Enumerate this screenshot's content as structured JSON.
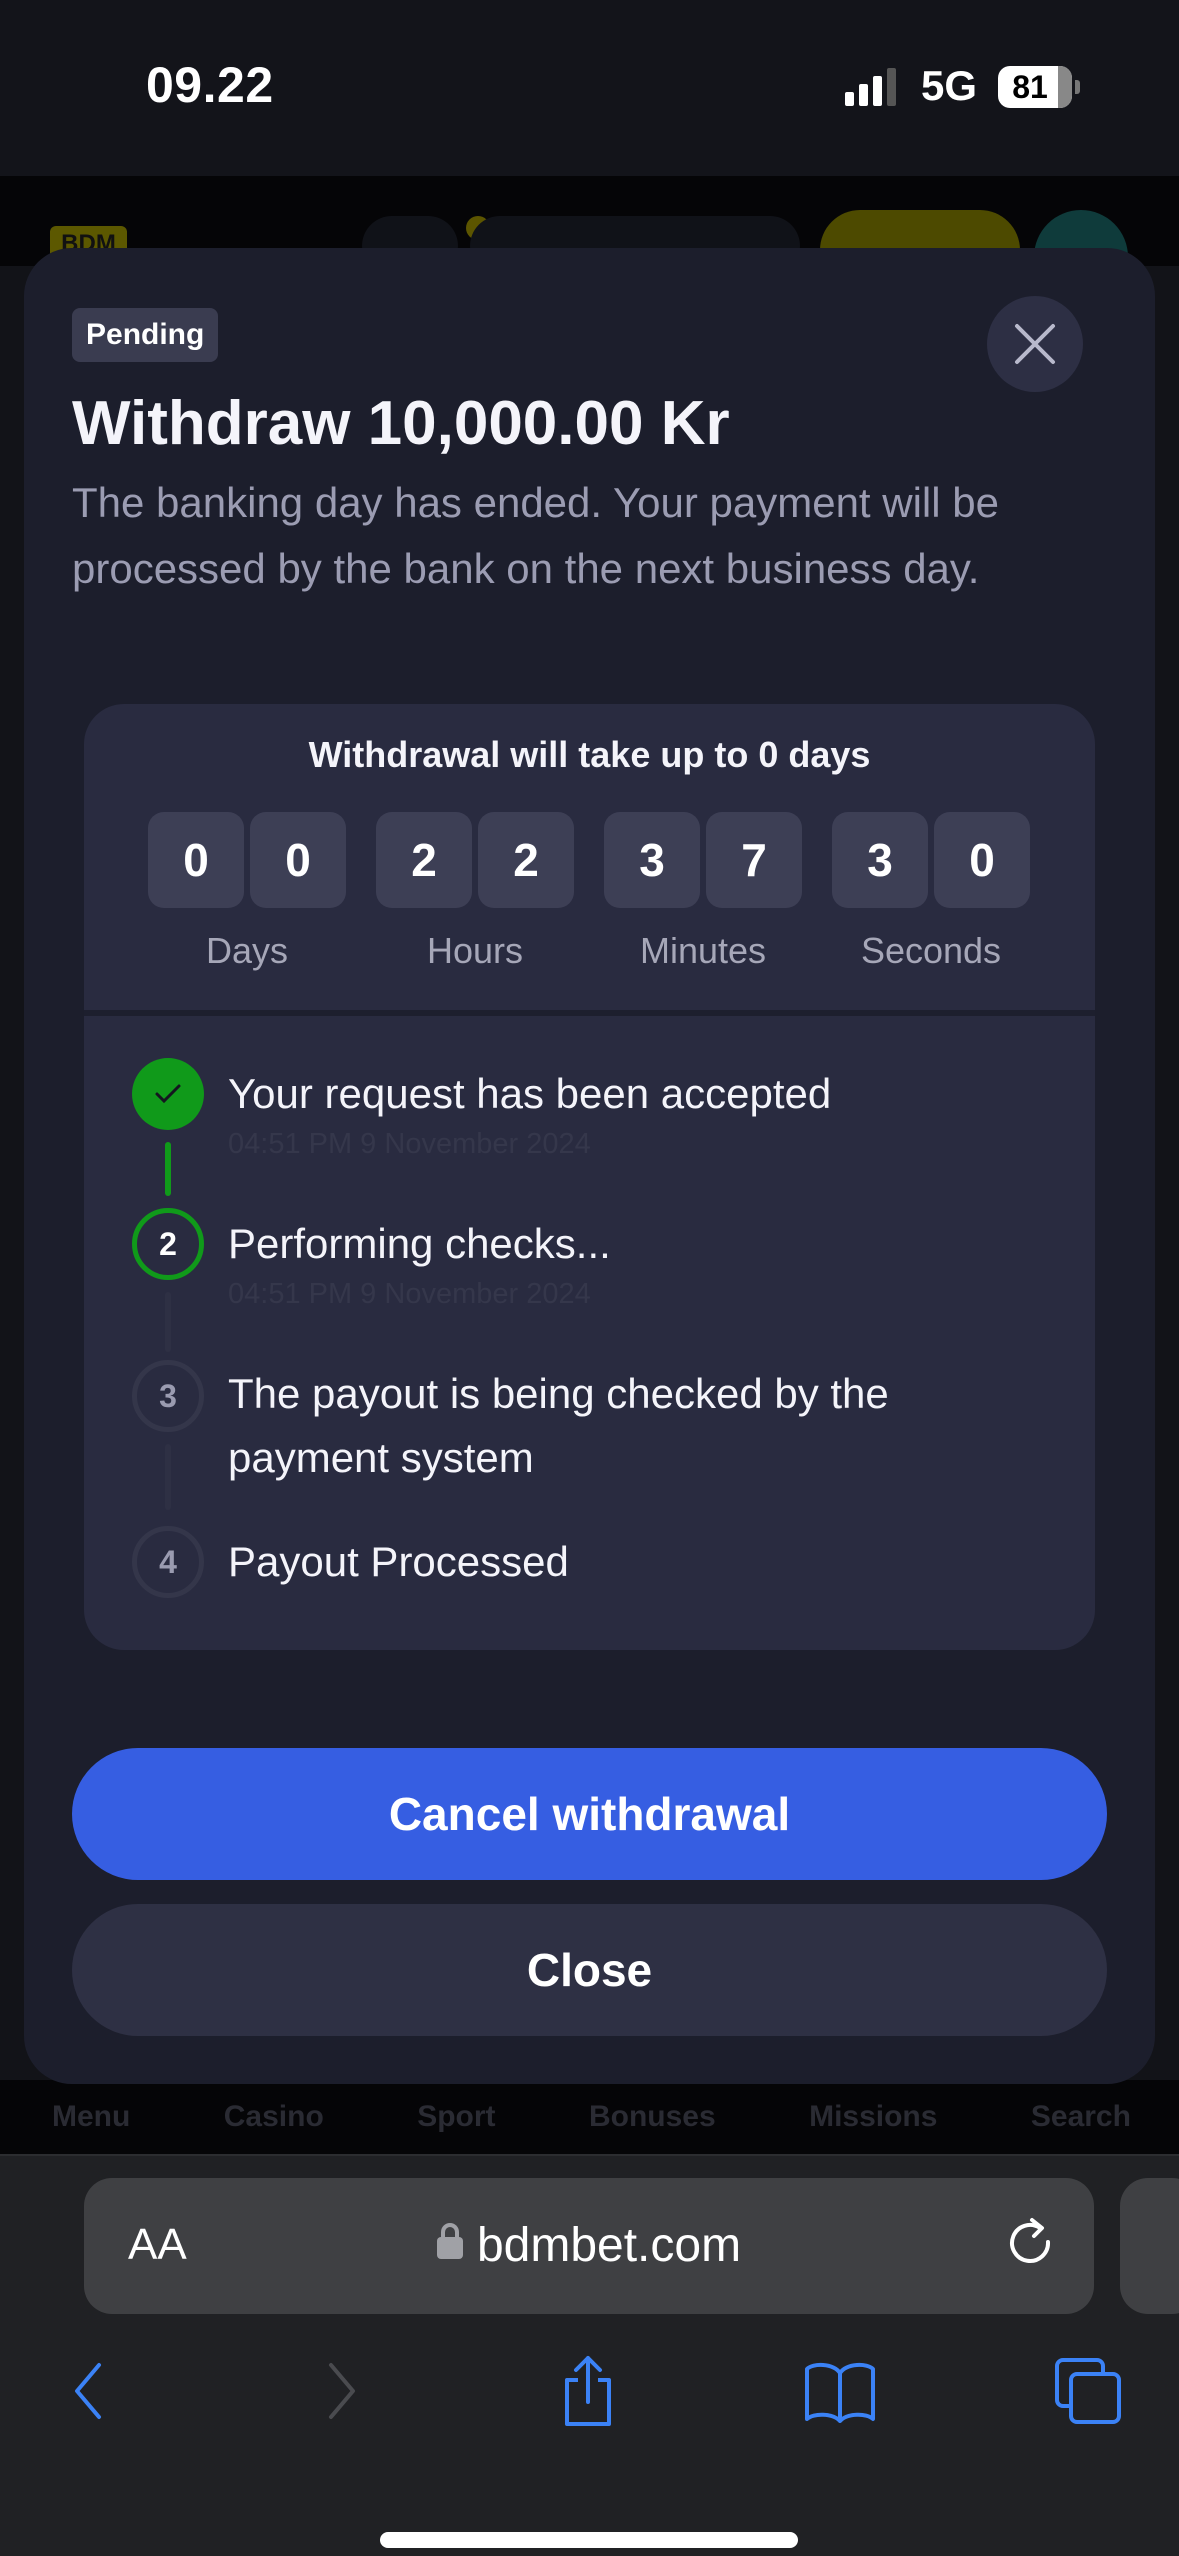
{
  "status_bar": {
    "time": "09.22",
    "network": "5G",
    "battery": "81"
  },
  "site": {
    "logo": "BDM",
    "nav": [
      "Menu",
      "Casino",
      "Sport",
      "Bonuses",
      "Missions",
      "Search"
    ]
  },
  "modal": {
    "badge": "Pending",
    "title": "Withdraw 10,000.00 Kr",
    "description": "The banking day has ended. Your payment will be processed by the bank on the next business day.",
    "countdown": {
      "title": "Withdrawal will take up to 0 days",
      "units": [
        {
          "label": "Days",
          "digits": [
            "0",
            "0"
          ]
        },
        {
          "label": "Hours",
          "digits": [
            "2",
            "2"
          ]
        },
        {
          "label": "Minutes",
          "digits": [
            "3",
            "7"
          ]
        },
        {
          "label": "Seconds",
          "digits": [
            "3",
            "0"
          ]
        }
      ]
    },
    "steps": [
      {
        "number": "1",
        "status": "done",
        "text": "Your request has been accepted",
        "time": "04:51 PM 9 November 2024"
      },
      {
        "number": "2",
        "status": "active",
        "text": "Performing checks...",
        "time": "04:51 PM 9 November 2024"
      },
      {
        "number": "3",
        "status": "pending",
        "text": "The payout is being checked by the payment system",
        "time": ""
      },
      {
        "number": "4",
        "status": "pending",
        "text": "Payout Processed",
        "time": ""
      }
    ],
    "cancel_label": "Cancel withdrawal",
    "close_label": "Close"
  },
  "colors": {
    "accent": "#365ee2",
    "success": "#109a1a",
    "modal_bg": "#1c1e2c",
    "panel_bg": "#292b40"
  },
  "browser": {
    "aa_label": "AA",
    "url": "bdmbet.com"
  }
}
